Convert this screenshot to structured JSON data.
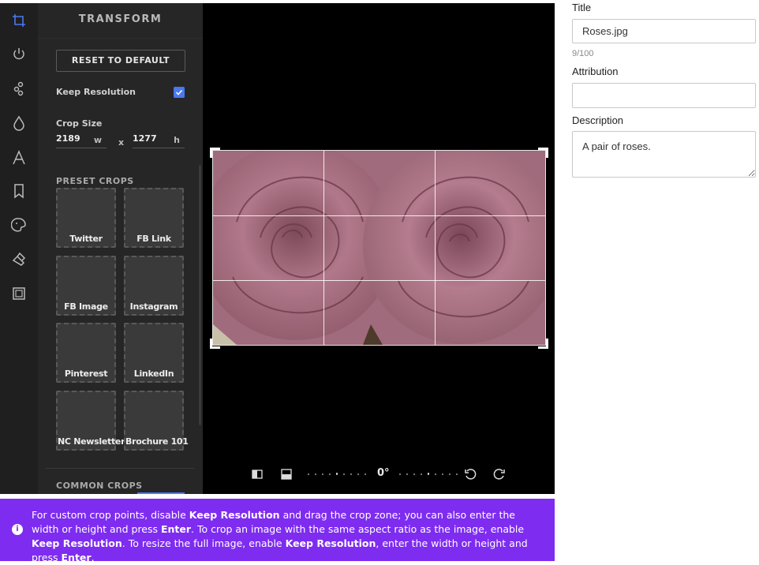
{
  "panel": {
    "title": "TRANSFORM",
    "reset_label": "RESET TO DEFAULT",
    "keep_resolution_label": "Keep Resolution",
    "keep_resolution_checked": true,
    "crop_size_label": "Crop Size",
    "width_value": "2189",
    "width_unit": "w",
    "height_value": "1277",
    "height_unit": "h",
    "times": "x",
    "preset_header": "PRESET CROPS",
    "presets": [
      "Twitter",
      "FB Link",
      "FB Image",
      "Instagram",
      "Pinterest",
      "LinkedIn",
      "NC Newsletter",
      "Brochure 101"
    ],
    "common_header": "COMMON CROPS"
  },
  "tools": [
    "crop-icon",
    "rotate-icon",
    "adjust-icon",
    "filter-drop-icon",
    "text-icon",
    "bookmark-icon",
    "paint-icon",
    "brush-icon",
    "frame-icon"
  ],
  "toolbar": {
    "angle": "0°"
  },
  "info": {
    "parts": [
      {
        "t": "For custom crop points, disable ",
        "b": false
      },
      {
        "t": "Keep Resolution",
        "b": true
      },
      {
        "t": " and drag the crop zone; you can also enter the width or height and press ",
        "b": false
      },
      {
        "t": "Enter",
        "b": true
      },
      {
        "t": ". To crop an image with the same aspect ratio as the image, enable ",
        "b": false
      },
      {
        "t": "Keep Resolution",
        "b": true
      },
      {
        "t": ". To resize the full image, enable ",
        "b": false
      },
      {
        "t": "Keep Resolution",
        "b": true
      },
      {
        "t": ", enter the width or height and press ",
        "b": false
      },
      {
        "t": "Enter",
        "b": true
      },
      {
        "t": ".",
        "b": false
      }
    ]
  },
  "form": {
    "title_label": "Title",
    "title_value": "Roses.jpg",
    "title_counter": "9/100",
    "attribution_label": "Attribution",
    "attribution_value": "",
    "description_label": "Description",
    "description_value": "A pair of roses."
  },
  "colors": {
    "accent": "#4a78f0",
    "info_bg": "#7e2cf0",
    "panel_bg": "#262626"
  }
}
